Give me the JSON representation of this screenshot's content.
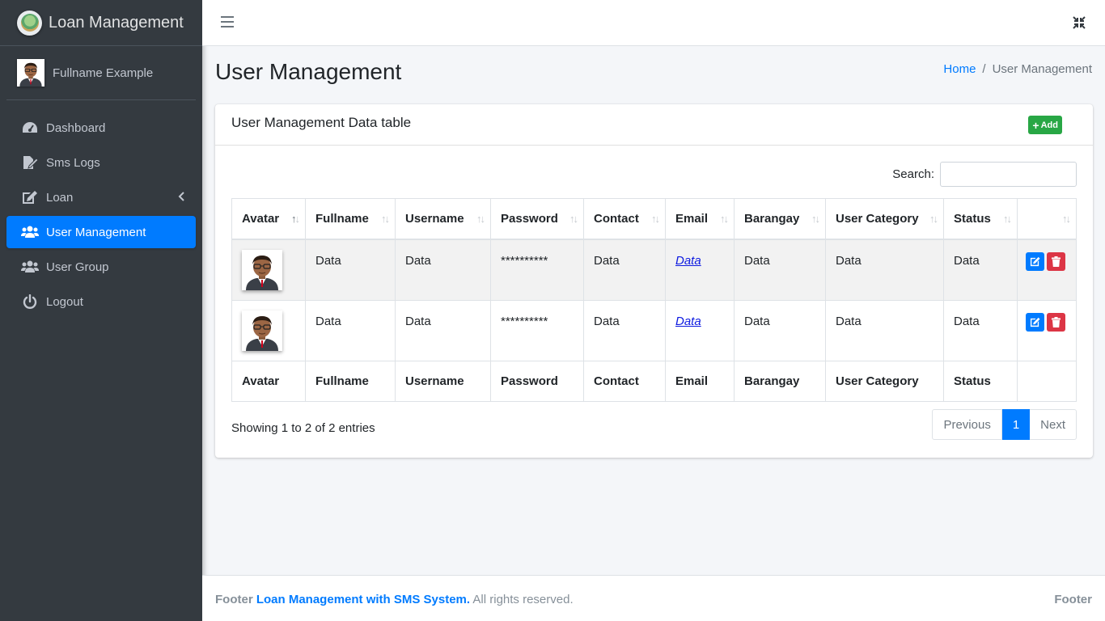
{
  "app": {
    "brand": "Loan Management"
  },
  "user": {
    "fullname": "Fullname Example"
  },
  "sidebar": {
    "items": [
      {
        "label": "Dashboard",
        "icon": "tachometer-icon"
      },
      {
        "label": "Sms Logs",
        "icon": "file-signature-icon"
      },
      {
        "label": "Loan",
        "icon": "edit-icon"
      },
      {
        "label": "User Management",
        "icon": "users-icon",
        "active": true
      },
      {
        "label": "User Group",
        "icon": "users-icon"
      },
      {
        "label": "Logout",
        "icon": "power-icon"
      }
    ]
  },
  "page": {
    "title": "User Management",
    "breadcrumb": {
      "home": "Home",
      "current": "User Management",
      "separator": "/"
    }
  },
  "card": {
    "title": "User Management Data table",
    "add_label": "Add",
    "search_label": "Search:",
    "search_value": "",
    "columns": [
      "Avatar",
      "Fullname",
      "Username",
      "Password",
      "Contact",
      "Email",
      "Barangay",
      "User Category",
      "Status"
    ],
    "rows": [
      {
        "fullname": "Data",
        "username": "Data",
        "password": "**********",
        "contact": "Data",
        "email": "Data",
        "barangay": "Data",
        "category": "Data",
        "status": "Data"
      },
      {
        "fullname": "Data",
        "username": "Data",
        "password": "**********",
        "contact": "Data",
        "email": "Data",
        "barangay": "Data",
        "category": "Data",
        "status": "Data"
      }
    ],
    "info": "Showing 1 to 2 of 2 entries",
    "pagination": {
      "previous": "Previous",
      "page": "1",
      "next": "Next"
    }
  },
  "footer": {
    "prefix": "Footer",
    "link": "Loan Management with SMS System.",
    "suffix": "All rights reserved.",
    "right": "Footer"
  },
  "colors": {
    "primary": "#007bff",
    "success": "#28a745",
    "danger": "#dc3545",
    "sidebar": "#343a40"
  }
}
